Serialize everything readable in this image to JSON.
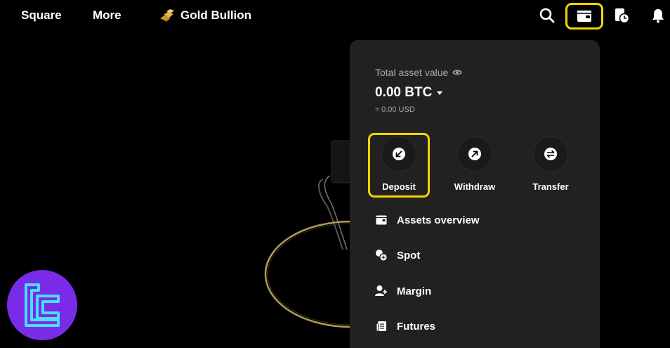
{
  "nav": {
    "square": "Square",
    "more": "More",
    "gold_bullion": "Gold Bullion"
  },
  "icons": {
    "search": "search-icon",
    "wallet": "wallet-icon",
    "orders": "orders-clock-icon",
    "bell": "bell-icon"
  },
  "wallet_panel": {
    "total_label": "Total asset value",
    "btc_value": "0.00 BTC",
    "usd_value": "≈ 0.00 USD",
    "actions": {
      "deposit": "Deposit",
      "withdraw": "Withdraw",
      "transfer": "Transfer"
    },
    "menu": {
      "assets_overview": "Assets overview",
      "spot": "Spot",
      "margin": "Margin",
      "futures": "Futures"
    }
  },
  "colors": {
    "highlight": "#f5d400",
    "panel_bg": "#212122",
    "page_bg": "#000000",
    "watermark": "#7a2be8"
  }
}
